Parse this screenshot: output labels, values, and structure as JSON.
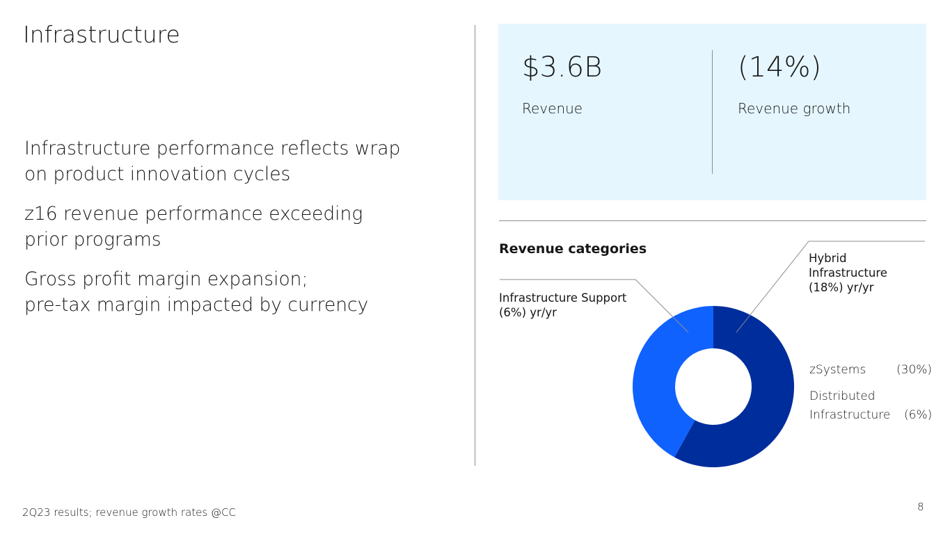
{
  "slide": {
    "title": "Infrastructure",
    "bullets": [
      {
        "line1": "Infrastructure performance reflects wrap",
        "line2": "on product innovation cycles"
      },
      {
        "line1": "z16 revenue performance exceeding",
        "line2": "prior programs"
      },
      {
        "line1": "Gross profit margin expansion;",
        "line2": "pre-tax margin impacted by currency"
      }
    ],
    "footnote": "2Q23 results; revenue growth rates @CC",
    "page_number": "8"
  },
  "kpis": [
    {
      "value": "$3.6B",
      "label": "Revenue"
    },
    {
      "value": "(14%)",
      "label": "Revenue growth"
    }
  ],
  "colors": {
    "panel_bg": "#e5f6ff",
    "hybrid_infrastructure": "#002d9c",
    "infrastructure_support": "#0f62fe",
    "divider": "#8d8d8d"
  },
  "chart_data": {
    "type": "pie",
    "title": "Revenue categories",
    "donut": true,
    "series": [
      {
        "name": "Hybrid Infrastructure",
        "value": 58
      },
      {
        "name": "Infrastructure Support",
        "value": 42
      }
    ],
    "callouts": {
      "hybrid": {
        "line1": "Hybrid",
        "line2": "Infrastructure",
        "line3": "(18%) yr/yr"
      },
      "support": {
        "line1": "Infrastructure Support",
        "line2": "(6%) yr/yr"
      }
    },
    "sub_items": [
      {
        "name_line1": "zSystems",
        "name_line2": "",
        "growth": "(30%)"
      },
      {
        "name_line1": "Distributed",
        "name_line2": "Infrastructure",
        "growth": "(6%)"
      }
    ]
  }
}
